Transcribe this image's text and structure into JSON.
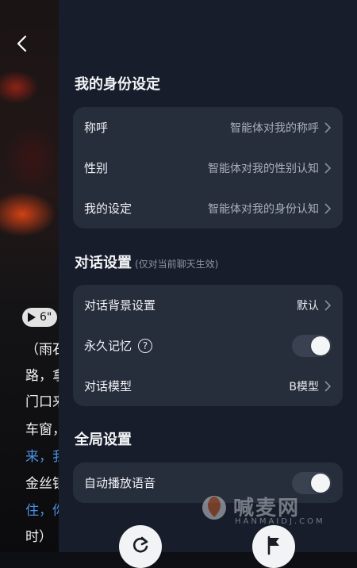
{
  "background_chat": {
    "audio_duration": "6\"",
    "story_lines": [
      "（雨石",
      "路，拿",
      "门口来",
      "车窗，",
      "来，我",
      "金丝银",
      "住，你",
      "时）"
    ]
  },
  "identity": {
    "title": "我的身份设定",
    "rows": [
      {
        "label": "称呼",
        "value": "智能体对我的称呼"
      },
      {
        "label": "性别",
        "value": "智能体对我的性别认知"
      },
      {
        "label": "我的设定",
        "value": "智能体对我的身份认知"
      }
    ]
  },
  "dialog": {
    "title": "对话设置",
    "subtitle": "(仅对当前聊天生效)",
    "background": {
      "label": "对话背景设置",
      "value": "默认"
    },
    "memory": {
      "label": "永久记忆",
      "help": "?",
      "enabled": false
    },
    "model": {
      "label": "对话模型",
      "value": "B模型"
    }
  },
  "global": {
    "title": "全局设置",
    "autoplay": {
      "label": "自动播放语音",
      "enabled": false
    }
  },
  "watermark": {
    "text": "喊麦网",
    "sub": "HANMAIDJ.COM"
  },
  "colors": {
    "panel": "#171d2a",
    "card": "#262d3b",
    "accent_blue": "#4a90e2"
  }
}
